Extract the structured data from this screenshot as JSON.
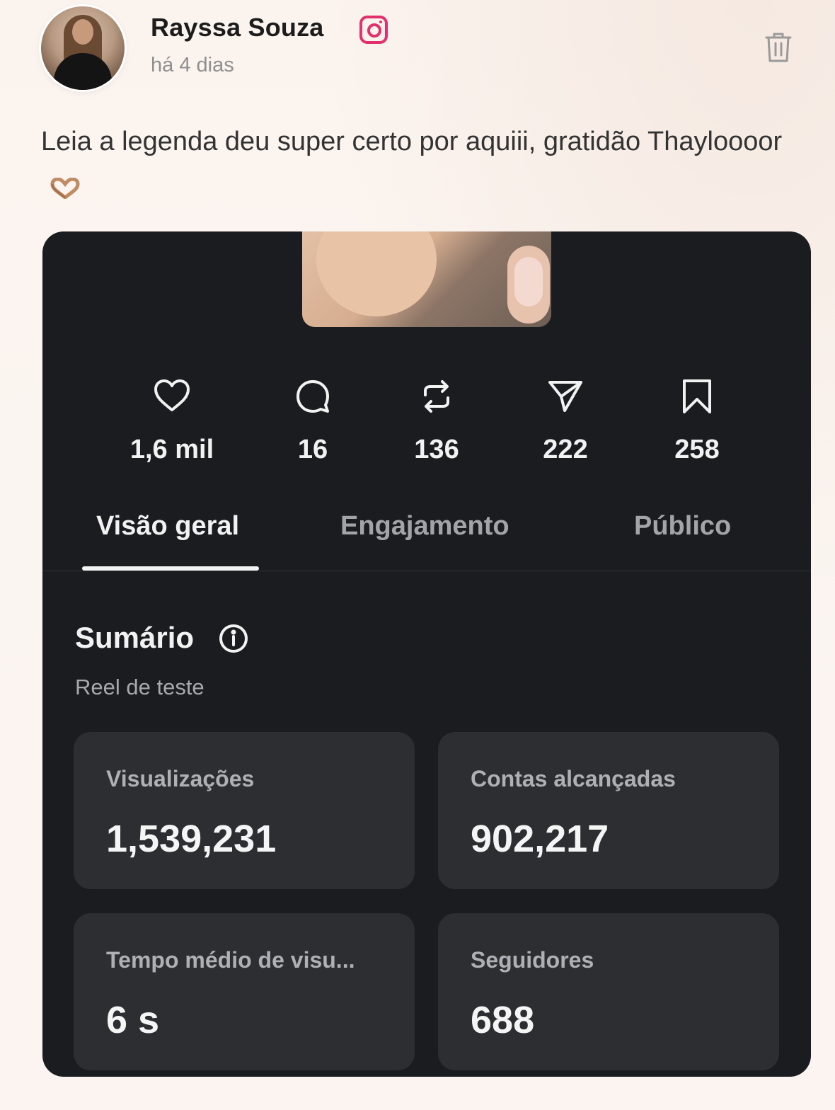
{
  "post": {
    "author": "Rayssa Souza",
    "time": "há 4 dias",
    "caption": "Leia a legenda deu super certo por aquiii, gratidão Thayloooor",
    "caption_emoji": "heart-hands"
  },
  "stats": [
    {
      "icon": "heart-icon",
      "value": "1,6 mil"
    },
    {
      "icon": "comment-icon",
      "value": "16"
    },
    {
      "icon": "repost-icon",
      "value": "136"
    },
    {
      "icon": "share-icon",
      "value": "222"
    },
    {
      "icon": "bookmark-icon",
      "value": "258"
    }
  ],
  "tabs": [
    {
      "label": "Visão geral",
      "active": true
    },
    {
      "label": "Engajamento",
      "active": false
    },
    {
      "label": "Público",
      "active": false
    }
  ],
  "summary": {
    "title": "Sumário",
    "subtitle": "Reel de teste",
    "metrics": [
      {
        "label": "Visualizações",
        "value": "1,539,231"
      },
      {
        "label": "Contas alcançadas",
        "value": "902,217"
      },
      {
        "label": "Tempo médio de visu...",
        "value": "6 s"
      },
      {
        "label": "Seguidores",
        "value": "688"
      }
    ]
  },
  "colors": {
    "instagram": "#e1306c",
    "panel": "#1b1c1f",
    "metric_card": "#2d2e32"
  }
}
